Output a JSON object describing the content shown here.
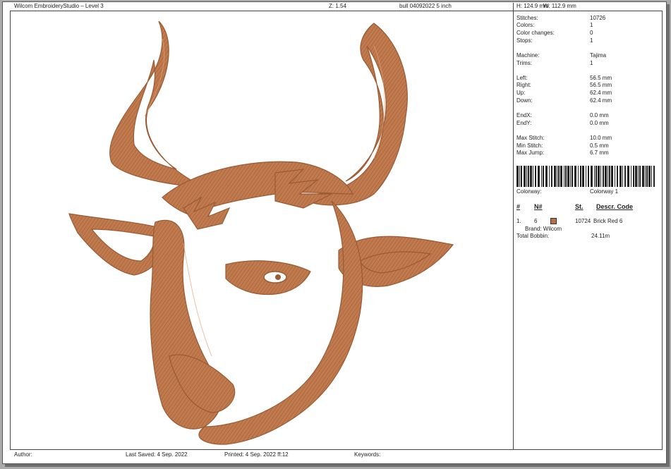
{
  "header": {
    "app_title": "Wilcom EmbroideryStudio – Level 3",
    "zoom": "Z: 1.54",
    "file_name": "bull 04092022  5 inch",
    "size_h": "H: 124.9 mm",
    "size_w": "W: 112.9 mm"
  },
  "stats": [
    {
      "label": "Stitches:",
      "value": "10726"
    },
    {
      "label": "Colors:",
      "value": "1"
    },
    {
      "label": "Color changes:",
      "value": "0"
    },
    {
      "label": "Stops:",
      "value": "1"
    },
    {
      "label": "Machine:",
      "value": "Tajima"
    },
    {
      "label": "Trims:",
      "value": "1"
    },
    {
      "label": "Left:",
      "value": "56.5 mm"
    },
    {
      "label": "Right:",
      "value": "56.5 mm"
    },
    {
      "label": "Up:",
      "value": "62.4 mm"
    },
    {
      "label": "Down:",
      "value": "62.4 mm"
    },
    {
      "label": "EndX:",
      "value": "0.0 mm"
    },
    {
      "label": "EndY:",
      "value": "0.0 mm"
    },
    {
      "label": "Max Stitch:",
      "value": "10.0 mm"
    },
    {
      "label": "Min Stitch:",
      "value": "0.5 mm"
    },
    {
      "label": "Max Jump:",
      "value": "6.7 mm"
    }
  ],
  "colorway": {
    "label": "Colorway:",
    "value": "Colorway 1"
  },
  "color_table": {
    "headers": {
      "num": "#",
      "needle": "N#",
      "stitches": "St.",
      "descr_code": "Descr. Code"
    },
    "rows": [
      {
        "num": "1.",
        "needle": "6",
        "swatch": "#b5704b",
        "stitches": "10724",
        "descr": "Brick Red 6",
        "brand": "Brand: Wilcom"
      }
    ],
    "bobbin_label": "Total Bobbin:",
    "bobbin_value": "24.11m"
  },
  "footer": {
    "author": "Author:",
    "last_saved": "Last Saved:  4 Sep. 2022",
    "printed": "Printed:  4 Sep. 2022 ff:12",
    "keywords": "Keywords:"
  },
  "design": {
    "thread_color": "#c07a4e",
    "thread_dark": "#9a5a33",
    "icon": "bull-head-embroidery"
  }
}
